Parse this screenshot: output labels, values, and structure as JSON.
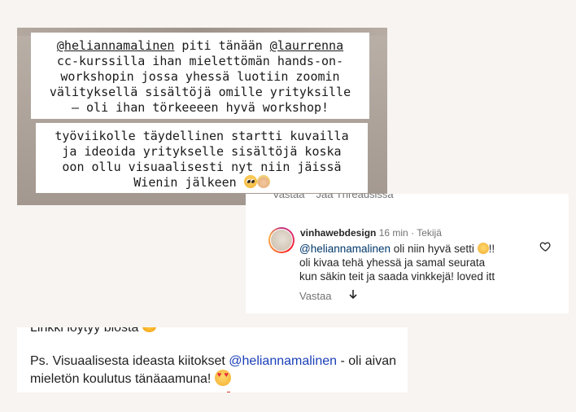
{
  "story": {
    "block1": {
      "mention1": "@heliannamalinen",
      "text1": " piti tänään ",
      "mention2": "@laurrenna",
      "lines": [
        "cc-kurssilla ihan mielettömän hands-on-",
        "workshopin jossa yhessä luotiin zoomin",
        "välityksellä sisältöjä omille yrityksille",
        "– oli ihan törkeeeen hyvä workshop!"
      ]
    },
    "block2": {
      "lines": [
        "työviikolle täydellinen startti kuvailla",
        "ja ideoida yritykselle sisältöjä koska",
        "oon ollu visuaalisesti nyt niin jäissä"
      ],
      "last_line": "Wienin jälkeen "
    },
    "emojis": [
      "pleading-face",
      "woman-blonde"
    ]
  },
  "comment": {
    "prev_actions": {
      "reply": "Vastaa",
      "share": "Jaa Threadsissa"
    },
    "username": "vinhawebdesign",
    "time": "16 min",
    "separator": " · ",
    "author_badge": "Tekijä",
    "mention": "@heliannamalinen",
    "text_line1": " oli niin hyvä setti ",
    "text_line1_end": "!!",
    "text_line2": "oli kivaa tehä yhessä ja samal seurata",
    "text_line3": "kun säkin teit ja saada vinkkejä! loved itt",
    "reply_label": "Vastaa",
    "icons": [
      "heart-icon",
      "download-arrow-icon"
    ]
  },
  "blog": {
    "cut_text": "Linkki löytyy biosta ",
    "para_start": "Ps. Visuaalisesta ideasta kiitokset ",
    "para_link": "@heliannamalinen",
    "para_mid": " - oli aivan mieletön koulutus tänäaamuna! ",
    "link_color": "#1a3fb7"
  }
}
